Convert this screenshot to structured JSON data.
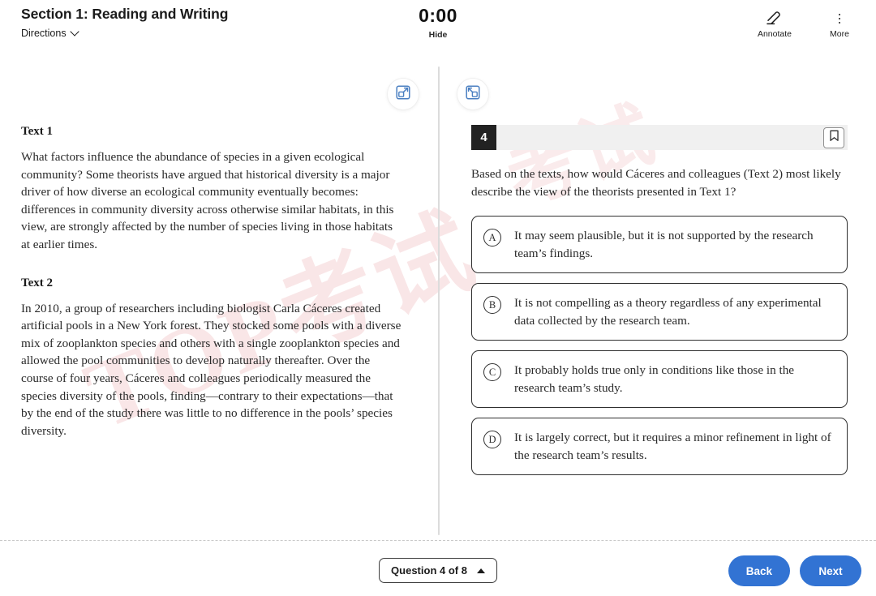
{
  "header": {
    "section_title": "Section 1: Reading and Writing",
    "directions_label": "Directions",
    "timer": "0:00",
    "hide_label": "Hide",
    "annotate_label": "Annotate",
    "more_label": "More"
  },
  "panel_controls": {
    "expand_left_icon": "expand-panel-icon",
    "expand_right_icon": "collapse-panel-icon"
  },
  "passage": {
    "text1": {
      "heading": "Text 1",
      "body": "What factors influence the abundance of species in a given ecological community? Some theorists have argued that historical diversity is a major driver of how diverse an ecological community eventually becomes: differences in community diversity across otherwise similar habitats, in this view, are strongly affected by the number of species living in those habitats at earlier times."
    },
    "text2": {
      "heading": "Text 2",
      "body": "In 2010, a group of researchers including biologist Carla Cáceres created artificial pools in a New York forest. They stocked some pools with a diverse mix of zooplankton species and others with a single zooplankton species and allowed the pool communities to develop naturally thereafter. Over the course of four years, Cáceres and colleagues periodically measured the species diversity of the pools, finding—contrary to their expectations—that by the end of the study there was little to no difference in the pools’ species diversity."
    }
  },
  "question": {
    "number": "4",
    "bookmark_icon": "bookmark-icon",
    "prompt": "Based on the texts, how would Cáceres and colleagues (Text 2) most likely describe the view of the theorists presented in Text 1?",
    "choices": [
      {
        "letter": "A",
        "text": "It may seem plausible, but it is not supported by the research team’s findings."
      },
      {
        "letter": "B",
        "text": "It is not compelling as a theory regardless of any experimental data collected by the research team."
      },
      {
        "letter": "C",
        "text": "It probably holds true only in conditions like those in the research team’s study."
      },
      {
        "letter": "D",
        "text": "It is largely correct, but it requires a minor refinement in light of the research team’s results."
      }
    ]
  },
  "footer": {
    "question_nav": "Question 4 of 8",
    "back_label": "Back",
    "next_label": "Next"
  },
  "watermark": {
    "line1": "TOP考试",
    "line2": "考试"
  },
  "colors": {
    "accent_blue": "#3273d3",
    "icon_blue": "#4a7fc1",
    "badge_dark": "#222222",
    "strip_gray": "#f0f0f0",
    "watermark_red": "#d4474e"
  }
}
